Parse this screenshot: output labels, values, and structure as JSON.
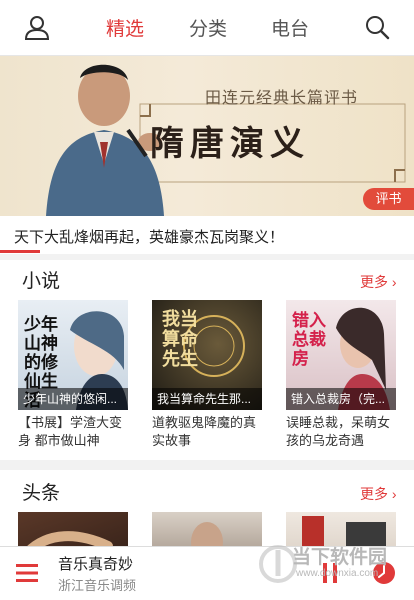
{
  "tabs": {
    "featured": "精选",
    "category": "分类",
    "radio": "电台"
  },
  "banner": {
    "subtitle": "田连元经典长篇评书",
    "title": "隋唐演义",
    "tag": "评书"
  },
  "headline": "天下大乱烽烟再起，英雄豪杰瓦岗聚义！",
  "novels": {
    "title": "小说",
    "more": "更多",
    "items": [
      {
        "cover_text": "少年山神的修仙生活",
        "caption": "少年山神的悠闲...",
        "desc": "【书展】学渣大变身 都市做山神"
      },
      {
        "cover_text": "我当算命先生",
        "caption": "我当算命先生那...",
        "desc": "道教驱鬼降魔的真实故事"
      },
      {
        "cover_text": "错入总裁房",
        "caption": "错入总裁房（完...",
        "desc": "误睡总裁，呆萌女孩的乌龙奇遇"
      }
    ]
  },
  "news": {
    "title": "头条",
    "more": "更多"
  },
  "player": {
    "title": "音乐真奇妙",
    "subtitle": "浙江音乐调频"
  },
  "watermark": {
    "text": "当下软件园",
    "url": "www.downxia.com"
  },
  "colors": {
    "accent": "#e03a3a",
    "tag_bg": "#e24b3b"
  },
  "icons": {
    "user": "user-icon",
    "search": "search-icon",
    "menu": "menu-icon",
    "pause": "pause-icon",
    "clock": "clock-icon"
  }
}
